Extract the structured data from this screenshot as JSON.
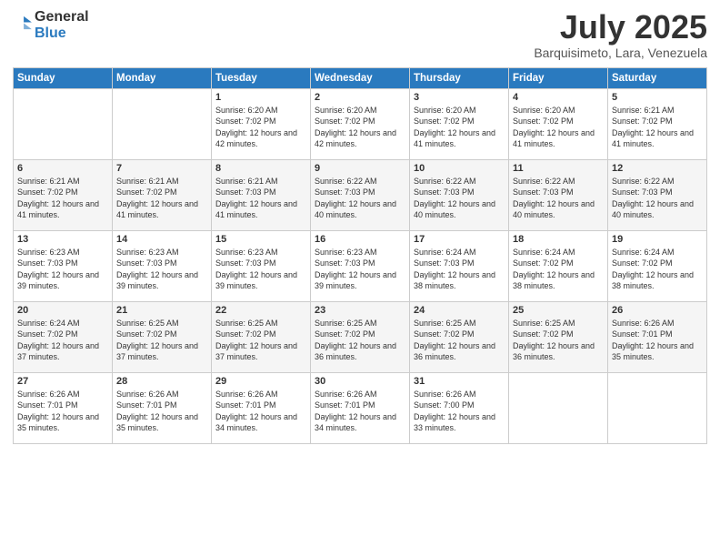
{
  "logo": {
    "line1": "General",
    "line2": "Blue"
  },
  "title": "July 2025",
  "subtitle": "Barquisimeto, Lara, Venezuela",
  "days_of_week": [
    "Sunday",
    "Monday",
    "Tuesday",
    "Wednesday",
    "Thursday",
    "Friday",
    "Saturday"
  ],
  "weeks": [
    [
      {
        "day": "",
        "info": ""
      },
      {
        "day": "",
        "info": ""
      },
      {
        "day": "1",
        "info": "Sunrise: 6:20 AM\nSunset: 7:02 PM\nDaylight: 12 hours and 42 minutes."
      },
      {
        "day": "2",
        "info": "Sunrise: 6:20 AM\nSunset: 7:02 PM\nDaylight: 12 hours and 42 minutes."
      },
      {
        "day": "3",
        "info": "Sunrise: 6:20 AM\nSunset: 7:02 PM\nDaylight: 12 hours and 41 minutes."
      },
      {
        "day": "4",
        "info": "Sunrise: 6:20 AM\nSunset: 7:02 PM\nDaylight: 12 hours and 41 minutes."
      },
      {
        "day": "5",
        "info": "Sunrise: 6:21 AM\nSunset: 7:02 PM\nDaylight: 12 hours and 41 minutes."
      }
    ],
    [
      {
        "day": "6",
        "info": "Sunrise: 6:21 AM\nSunset: 7:02 PM\nDaylight: 12 hours and 41 minutes."
      },
      {
        "day": "7",
        "info": "Sunrise: 6:21 AM\nSunset: 7:02 PM\nDaylight: 12 hours and 41 minutes."
      },
      {
        "day": "8",
        "info": "Sunrise: 6:21 AM\nSunset: 7:03 PM\nDaylight: 12 hours and 41 minutes."
      },
      {
        "day": "9",
        "info": "Sunrise: 6:22 AM\nSunset: 7:03 PM\nDaylight: 12 hours and 40 minutes."
      },
      {
        "day": "10",
        "info": "Sunrise: 6:22 AM\nSunset: 7:03 PM\nDaylight: 12 hours and 40 minutes."
      },
      {
        "day": "11",
        "info": "Sunrise: 6:22 AM\nSunset: 7:03 PM\nDaylight: 12 hours and 40 minutes."
      },
      {
        "day": "12",
        "info": "Sunrise: 6:22 AM\nSunset: 7:03 PM\nDaylight: 12 hours and 40 minutes."
      }
    ],
    [
      {
        "day": "13",
        "info": "Sunrise: 6:23 AM\nSunset: 7:03 PM\nDaylight: 12 hours and 39 minutes."
      },
      {
        "day": "14",
        "info": "Sunrise: 6:23 AM\nSunset: 7:03 PM\nDaylight: 12 hours and 39 minutes."
      },
      {
        "day": "15",
        "info": "Sunrise: 6:23 AM\nSunset: 7:03 PM\nDaylight: 12 hours and 39 minutes."
      },
      {
        "day": "16",
        "info": "Sunrise: 6:23 AM\nSunset: 7:03 PM\nDaylight: 12 hours and 39 minutes."
      },
      {
        "day": "17",
        "info": "Sunrise: 6:24 AM\nSunset: 7:03 PM\nDaylight: 12 hours and 38 minutes."
      },
      {
        "day": "18",
        "info": "Sunrise: 6:24 AM\nSunset: 7:02 PM\nDaylight: 12 hours and 38 minutes."
      },
      {
        "day": "19",
        "info": "Sunrise: 6:24 AM\nSunset: 7:02 PM\nDaylight: 12 hours and 38 minutes."
      }
    ],
    [
      {
        "day": "20",
        "info": "Sunrise: 6:24 AM\nSunset: 7:02 PM\nDaylight: 12 hours and 37 minutes."
      },
      {
        "day": "21",
        "info": "Sunrise: 6:25 AM\nSunset: 7:02 PM\nDaylight: 12 hours and 37 minutes."
      },
      {
        "day": "22",
        "info": "Sunrise: 6:25 AM\nSunset: 7:02 PM\nDaylight: 12 hours and 37 minutes."
      },
      {
        "day": "23",
        "info": "Sunrise: 6:25 AM\nSunset: 7:02 PM\nDaylight: 12 hours and 36 minutes."
      },
      {
        "day": "24",
        "info": "Sunrise: 6:25 AM\nSunset: 7:02 PM\nDaylight: 12 hours and 36 minutes."
      },
      {
        "day": "25",
        "info": "Sunrise: 6:25 AM\nSunset: 7:02 PM\nDaylight: 12 hours and 36 minutes."
      },
      {
        "day": "26",
        "info": "Sunrise: 6:26 AM\nSunset: 7:01 PM\nDaylight: 12 hours and 35 minutes."
      }
    ],
    [
      {
        "day": "27",
        "info": "Sunrise: 6:26 AM\nSunset: 7:01 PM\nDaylight: 12 hours and 35 minutes."
      },
      {
        "day": "28",
        "info": "Sunrise: 6:26 AM\nSunset: 7:01 PM\nDaylight: 12 hours and 35 minutes."
      },
      {
        "day": "29",
        "info": "Sunrise: 6:26 AM\nSunset: 7:01 PM\nDaylight: 12 hours and 34 minutes."
      },
      {
        "day": "30",
        "info": "Sunrise: 6:26 AM\nSunset: 7:01 PM\nDaylight: 12 hours and 34 minutes."
      },
      {
        "day": "31",
        "info": "Sunrise: 6:26 AM\nSunset: 7:00 PM\nDaylight: 12 hours and 33 minutes."
      },
      {
        "day": "",
        "info": ""
      },
      {
        "day": "",
        "info": ""
      }
    ]
  ]
}
